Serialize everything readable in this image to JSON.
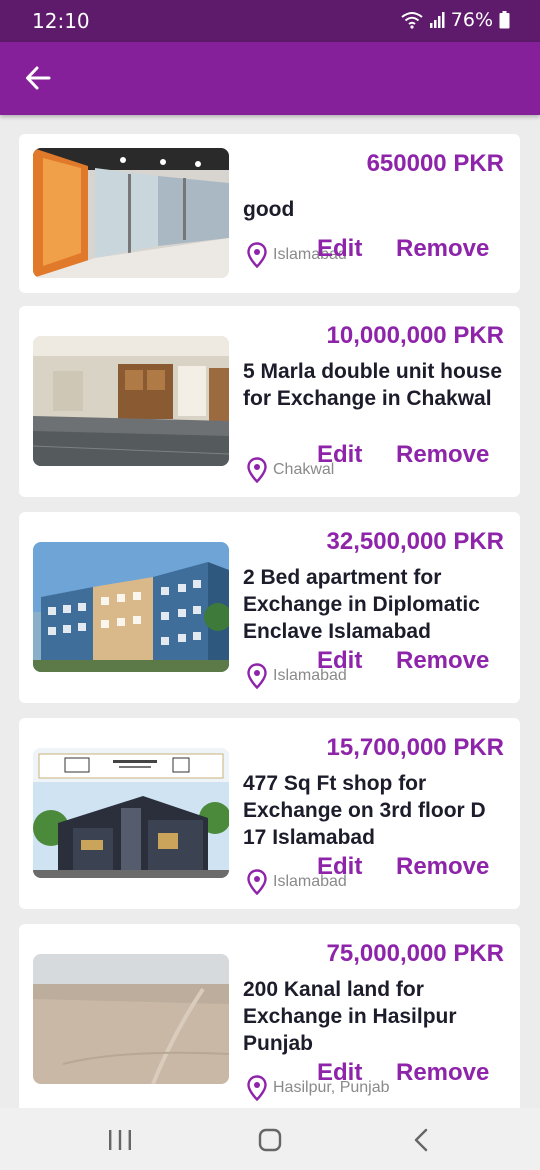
{
  "status_bar": {
    "time": "12:10",
    "battery": "76%"
  },
  "app_bar": {
    "back_icon": "arrow-left-icon"
  },
  "colors": {
    "app_bar": "#861f9a",
    "status_bar": "#5e1a6b",
    "accent": "#8e24aa",
    "title_text": "#1c1c2b"
  },
  "listings": [
    {
      "price": "650000 PKR",
      "title": "good",
      "location": "Islamabad",
      "edit_label": "Edit",
      "remove_label": "Remove",
      "image": "office-interior"
    },
    {
      "price": "10,000,000 PKR",
      "title": "5 Marla double unit house for Exchange in Chakwal",
      "location": "Chakwal",
      "edit_label": "Edit",
      "remove_label": "Remove",
      "image": "house-interior"
    },
    {
      "price": "32,500,000 PKR",
      "title": "2 Bed apartment for Exchange in Diplomatic Enclave Islamabad",
      "location": "Islamabad",
      "edit_label": "Edit",
      "remove_label": "Remove",
      "image": "apartment-building"
    },
    {
      "price": "15,700,000 PKR",
      "title": "477 Sq Ft shop for Exchange on 3rd floor D 17 Islamabad",
      "location": "Islamabad",
      "edit_label": "Edit",
      "remove_label": "Remove",
      "image": "shopping-mall"
    },
    {
      "price": "75,000,000 PKR",
      "title": "200 Kanal land for Exchange in Hasilpur Punjab",
      "location": "Hasilpur, Punjab",
      "edit_label": "Edit",
      "remove_label": "Remove",
      "image": "open-land"
    }
  ],
  "nav_bar": {
    "recents_icon": "recent-apps-icon",
    "home_icon": "home-icon",
    "back_icon": "nav-back-icon"
  }
}
